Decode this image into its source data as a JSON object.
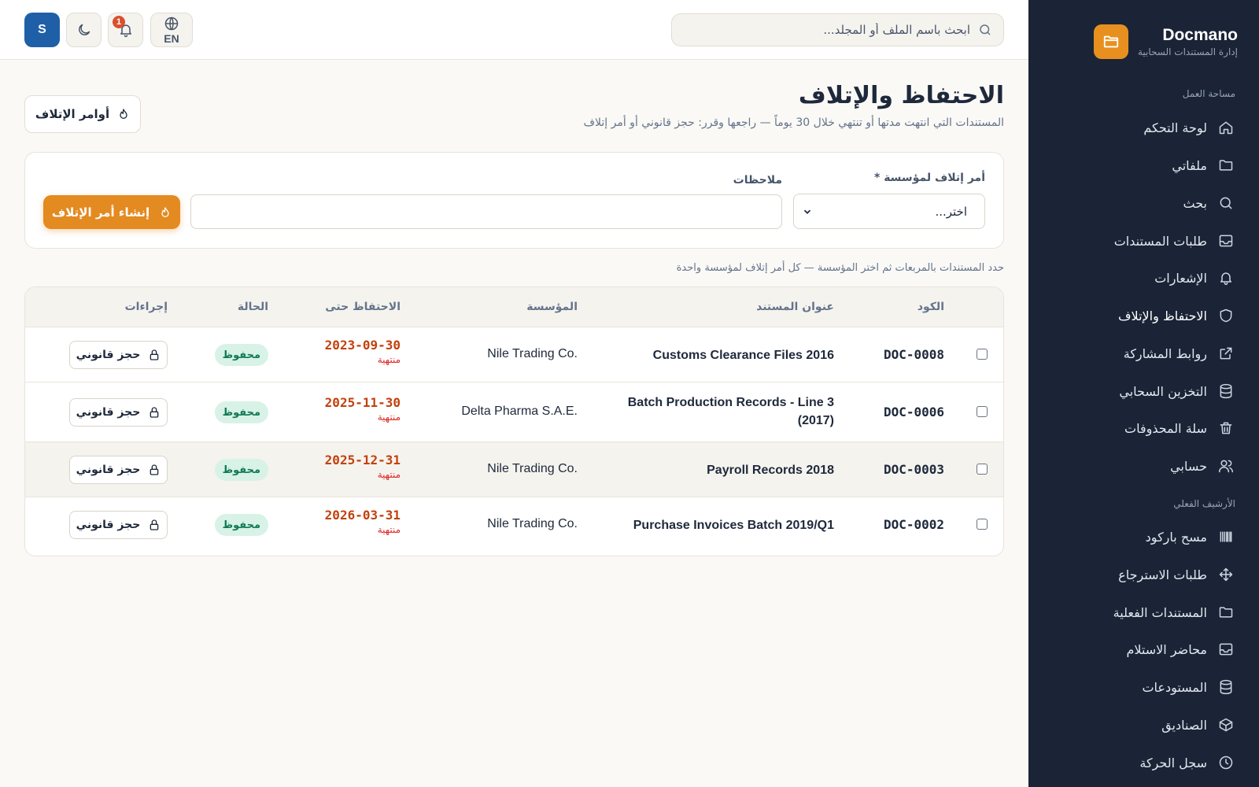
{
  "brand": {
    "name": "Docmano",
    "subtitle": "إدارة المستندات السحابية"
  },
  "sidebar": {
    "sections": [
      {
        "title": "مساحة العمل"
      },
      {
        "title": "الأرشيف الفعلي"
      }
    ],
    "items": [
      {
        "label": "لوحة التحكم",
        "icon": "home-icon"
      },
      {
        "label": "ملفاتي",
        "icon": "folder-icon"
      },
      {
        "label": "بحث",
        "icon": "search-icon"
      },
      {
        "label": "طلبات المستندات",
        "icon": "inbox-icon"
      },
      {
        "label": "الإشعارات",
        "icon": "bell-icon"
      },
      {
        "label": "الاحتفاظ والإتلاف",
        "icon": "shield-icon"
      },
      {
        "label": "روابط المشاركة",
        "icon": "external-link-icon"
      },
      {
        "label": "التخزين السحابي",
        "icon": "database-icon"
      },
      {
        "label": "سلة المحذوفات",
        "icon": "trash-icon"
      },
      {
        "label": "حسابي",
        "icon": "users-icon"
      },
      {
        "label": "مسح باركود",
        "icon": "barcode-icon"
      },
      {
        "label": "طلبات الاسترجاع",
        "icon": "move-icon"
      },
      {
        "label": "المستندات الفعلية",
        "icon": "folder-icon"
      },
      {
        "label": "محاضر الاستلام",
        "icon": "inbox-icon"
      },
      {
        "label": "المستودعات",
        "icon": "database-icon"
      },
      {
        "label": "الصناديق",
        "icon": "box-icon"
      },
      {
        "label": "سجل الحركة",
        "icon": "clock-icon"
      }
    ]
  },
  "topbar": {
    "search_placeholder": "ابحث باسم الملف أو المجلد...",
    "lang_label": "EN",
    "notification_count": "1",
    "avatar_initial": "S"
  },
  "page": {
    "title": "الاحتفاظ والإتلاف",
    "subtitle": "المستندات التي انتهت مدتها أو تنتهي خلال 30 يوماً — راجعها وقرر: حجز قانوني أو أمر إتلاف",
    "orders_button": "أوامر الإتلاف"
  },
  "form": {
    "org_label": "أمر إتلاف لمؤسسة *",
    "org_select_value": "اختر...",
    "notes_label": "ملاحظات",
    "notes_value": "",
    "create_button": "إنشاء أمر الإتلاف"
  },
  "hint": "حدد المستندات بالمربعات ثم اختر المؤسسة — كل أمر إتلاف لمؤسسة واحدة",
  "table": {
    "headers": {
      "code": "الكود",
      "title": "عنوان المستند",
      "org": "المؤسسة",
      "retention": "الاحتفاظ حتى",
      "status": "الحالة",
      "actions": "إجراءات"
    },
    "rows": [
      {
        "code": "DOC-0008",
        "title": "Customs Clearance Files 2016",
        "org": "Nile Trading Co.",
        "retention_date": "2023-09-30",
        "retention_status": "منتهية",
        "status": "محفوظ",
        "action": "حجز قانوني",
        "checked": false,
        "highlighted": false
      },
      {
        "code": "DOC-0006",
        "title": "Batch Production Records - Line 3 (2017)",
        "org": "Delta Pharma S.A.E.",
        "retention_date": "2025-11-30",
        "retention_status": "منتهية",
        "status": "محفوظ",
        "action": "حجز قانوني",
        "checked": false,
        "highlighted": false
      },
      {
        "code": "DOC-0003",
        "title": "Payroll Records 2018",
        "org": "Nile Trading Co.",
        "retention_date": "2025-12-31",
        "retention_status": "منتهية",
        "status": "محفوظ",
        "action": "حجز قانوني",
        "checked": false,
        "highlighted": true
      },
      {
        "code": "DOC-0002",
        "title": "Purchase Invoices Batch 2019/Q1",
        "org": "Nile Trading Co.",
        "retention_date": "2026-03-31",
        "retention_status": "منتهية",
        "status": "محفوظ",
        "action": "حجز قانوني",
        "checked": false,
        "highlighted": false
      }
    ]
  },
  "colors": {
    "sidebar_bg": "#1b2436",
    "accent": "#e38a21",
    "avatar_bg": "#1f5fa8",
    "expired_date": "#c2410c",
    "status_pill_bg": "#d8f2e8",
    "status_pill_text": "#0f7a52"
  }
}
